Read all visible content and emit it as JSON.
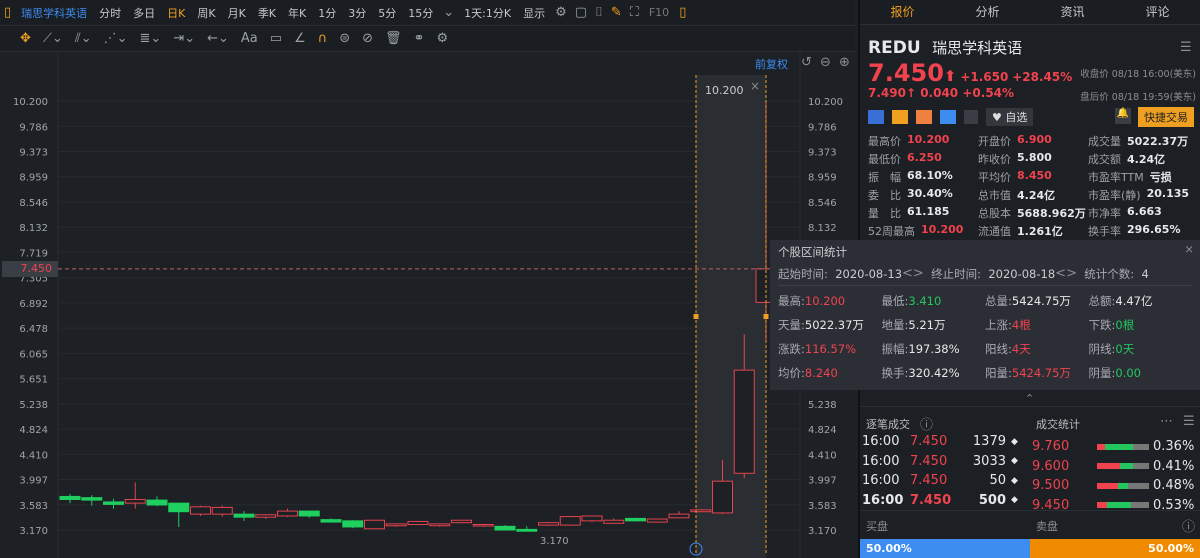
{
  "toolbar": {
    "items": [
      "瑞思学科英语",
      "分时",
      "多日",
      "日K",
      "周K",
      "月K",
      "季K",
      "年K",
      "1分",
      "3分",
      "5分",
      "15分"
    ],
    "active": "日K",
    "period_select": "1天:1分K",
    "display": "显示",
    "f10": "F10"
  },
  "chart_toolbar": {
    "adjust": "前复权",
    "text_tool": "Aa"
  },
  "range_label": "10.200",
  "current_price_tag": "7.450",
  "chart_data": {
    "type": "candlestick",
    "title": "REDU 日K",
    "yticks": [
      "10.200",
      "9.786",
      "9.373",
      "8.959",
      "8.546",
      "8.132",
      "7.719",
      "7.305",
      "6.892",
      "6.478",
      "6.065",
      "5.651",
      "5.238",
      "4.824",
      "4.410",
      "3.997",
      "3.583",
      "3.170"
    ],
    "ylim": [
      3.17,
      10.2
    ],
    "min_label": "3.170",
    "candles": [
      [
        3.72,
        3.76,
        3.61,
        3.67
      ],
      [
        3.7,
        3.74,
        3.57,
        3.66
      ],
      [
        3.63,
        3.68,
        3.52,
        3.59
      ],
      [
        3.61,
        3.95,
        3.52,
        3.67
      ],
      [
        3.66,
        3.72,
        3.56,
        3.58
      ],
      [
        3.61,
        3.61,
        3.22,
        3.47
      ],
      [
        3.43,
        3.57,
        3.4,
        3.55
      ],
      [
        3.43,
        3.57,
        3.39,
        3.54
      ],
      [
        3.43,
        3.48,
        3.32,
        3.38
      ],
      [
        3.38,
        3.42,
        3.35,
        3.42
      ],
      [
        3.4,
        3.52,
        3.38,
        3.48
      ],
      [
        3.48,
        3.49,
        3.37,
        3.4
      ],
      [
        3.34,
        3.36,
        3.3,
        3.3
      ],
      [
        3.32,
        3.33,
        3.2,
        3.22
      ],
      [
        3.19,
        3.33,
        3.19,
        3.33
      ],
      [
        3.24,
        3.27,
        3.22,
        3.27
      ],
      [
        3.26,
        3.32,
        3.25,
        3.31
      ],
      [
        3.24,
        3.27,
        3.22,
        3.27
      ],
      [
        3.29,
        3.34,
        3.28,
        3.33
      ],
      [
        3.24,
        3.27,
        3.22,
        3.26
      ],
      [
        3.23,
        3.25,
        3.17,
        3.17
      ],
      [
        3.18,
        3.23,
        3.17,
        3.15
      ],
      [
        3.25,
        3.3,
        3.24,
        3.29
      ],
      [
        3.25,
        3.39,
        3.24,
        3.39
      ],
      [
        3.32,
        3.4,
        3.3,
        3.4
      ],
      [
        3.28,
        3.36,
        3.27,
        3.33
      ],
      [
        3.36,
        3.37,
        3.31,
        3.32
      ],
      [
        3.3,
        3.35,
        3.29,
        3.35
      ],
      [
        3.37,
        3.48,
        3.37,
        3.43
      ],
      [
        3.47,
        3.5,
        3.46,
        3.5
      ],
      [
        3.45,
        4.32,
        3.43,
        3.97
      ],
      [
        4.1,
        6.38,
        4.02,
        5.79
      ],
      [
        6.9,
        10.2,
        6.25,
        7.45
      ]
    ]
  },
  "quote": {
    "tabs": [
      "报价",
      "分析",
      "资讯",
      "评论"
    ],
    "symbol": "REDU",
    "name": "瑞思学科英语",
    "price": "7.450",
    "arrow": "⬆",
    "change": "+1.650",
    "change_pct": "+28.45%",
    "close_label": "收盘价 08/18 16:00(美东)",
    "ah_price": "7.490↑",
    "ah_change": "0.040",
    "ah_pct": "+0.54%",
    "ah_label": "盘后价 08/18 19:59(美东)",
    "watch": "自选",
    "trade": "快捷交易",
    "stats": [
      [
        [
          "最高价",
          "10.200",
          "red"
        ],
        [
          "开盘价",
          "6.900",
          "red"
        ],
        [
          "成交量",
          "5022.37万",
          "wh"
        ]
      ],
      [
        [
          "最低价",
          "6.250",
          "red"
        ],
        [
          "昨收价",
          "5.800",
          "wh"
        ],
        [
          "成交额",
          "4.24亿",
          "wh"
        ]
      ],
      [
        [
          "振　幅",
          "68.10%",
          "wh"
        ],
        [
          "平均价",
          "8.450",
          "red"
        ],
        [
          "市盈率TTM",
          "亏损",
          "wh"
        ]
      ],
      [
        [
          "委　比",
          "30.40%",
          "wh"
        ],
        [
          "总市值",
          "4.24亿",
          "wh"
        ],
        [
          "市盈率(静)",
          "20.135",
          "wh"
        ]
      ],
      [
        [
          "量　比",
          "61.185",
          "wh"
        ],
        [
          "总股本",
          "5688.962万",
          "wh"
        ],
        [
          "市净率",
          "6.663",
          "wh"
        ]
      ],
      [
        [
          "52周最高",
          "10.200",
          "red"
        ],
        [
          "流通值",
          "1.261亿",
          "wh"
        ],
        [
          "换手率",
          "296.65%",
          "wh"
        ]
      ]
    ]
  },
  "range_stats": {
    "title": "个股区间统计",
    "start_label": "起始时间:",
    "start": "2020-08-13",
    "end_label": "终止时间:",
    "end": "2020-08-18",
    "count_label": "统计个数:",
    "count": "4",
    "rows": [
      [
        [
          "最高:",
          "10.200",
          "red"
        ],
        [
          "最低:",
          "3.410",
          "green"
        ],
        [
          "总量:",
          "5424.75万",
          "wh"
        ],
        [
          "总额:",
          "4.47亿",
          "wh"
        ]
      ],
      [
        [
          "天量:",
          "5022.37万",
          "wh"
        ],
        [
          "地量:",
          "5.21万",
          "wh"
        ],
        [
          "上涨:",
          "4根",
          "red"
        ],
        [
          "下跌:",
          "0根",
          "green"
        ]
      ],
      [
        [
          "涨跌:",
          "116.57%",
          "red"
        ],
        [
          "振幅:",
          "197.38%",
          "wh"
        ],
        [
          "阳线:",
          "4天",
          "red"
        ],
        [
          "阴线:",
          "0天",
          "green"
        ]
      ],
      [
        [
          "均价:",
          "8.240",
          "red"
        ],
        [
          "换手:",
          "320.42%",
          "wh"
        ],
        [
          "阳量:",
          "5424.75万",
          "red"
        ],
        [
          "阴量:",
          "0.00",
          "green"
        ]
      ]
    ]
  },
  "ticks": {
    "title": "逐笔成交",
    "rows": [
      [
        "16:00",
        "7.450",
        "1379"
      ],
      [
        "16:00",
        "7.450",
        "3033"
      ],
      [
        "16:00",
        "7.450",
        "50"
      ],
      [
        "16:00",
        "7.450",
        "500"
      ]
    ]
  },
  "volume_stats": {
    "title": "成交统计",
    "rows": [
      [
        "9.760",
        "0.36%",
        0.15,
        0.55
      ],
      [
        "9.600",
        "0.41%",
        0.45,
        0.25
      ],
      [
        "9.500",
        "0.48%",
        0.4,
        0.2
      ],
      [
        "9.450",
        "0.53%",
        0.2,
        0.45
      ]
    ]
  },
  "order_flow": {
    "buy_label": "买盘",
    "sell_label": "卖盘",
    "buy_pct": "50.00%",
    "sell_pct": "50.00%",
    "buy": 50,
    "sell": 50
  }
}
